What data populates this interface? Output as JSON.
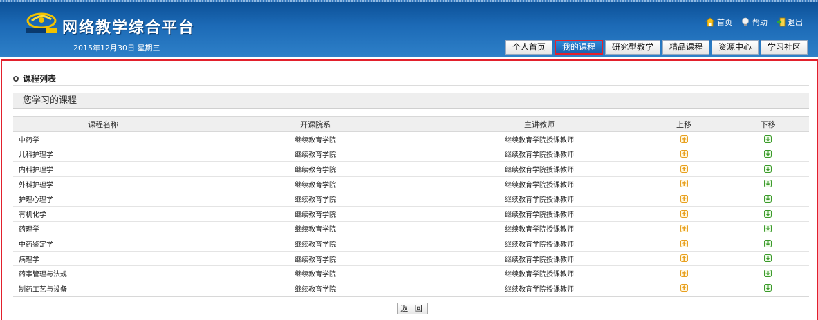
{
  "header": {
    "site_title": "网络教学综合平台",
    "date_text": "2015年12月30日 星期三",
    "logo_icon": "tsinghua-logo-icon",
    "top_links": [
      {
        "label": "首页",
        "icon": "home-icon"
      },
      {
        "label": "帮助",
        "icon": "help-bulb-icon"
      },
      {
        "label": "退出",
        "icon": "exit-icon"
      }
    ],
    "nav_tabs": [
      {
        "label": "个人首页",
        "active": false
      },
      {
        "label": "我的课程",
        "active": true
      },
      {
        "label": "研究型教学",
        "active": false
      },
      {
        "label": "精品课程",
        "active": false
      },
      {
        "label": "资源中心",
        "active": false
      },
      {
        "label": "学习社区",
        "active": false
      }
    ]
  },
  "main": {
    "section_title": "课程列表",
    "subheader": "您学习的课程",
    "table": {
      "columns": [
        "课程名称",
        "开课院系",
        "主讲教师",
        "上移",
        "下移"
      ],
      "rows": [
        {
          "name": "中药学",
          "dept": "继续教育学院",
          "teacher": "继续教育学院授课教师"
        },
        {
          "name": "儿科护理学",
          "dept": "继续教育学院",
          "teacher": "继续教育学院授课教师"
        },
        {
          "name": "内科护理学",
          "dept": "继续教育学院",
          "teacher": "继续教育学院授课教师"
        },
        {
          "name": "外科护理学",
          "dept": "继续教育学院",
          "teacher": "继续教育学院授课教师"
        },
        {
          "name": "护理心理学",
          "dept": "继续教育学院",
          "teacher": "继续教育学院授课教师"
        },
        {
          "name": "有机化学",
          "dept": "继续教育学院",
          "teacher": "继续教育学院授课教师"
        },
        {
          "name": "药理学",
          "dept": "继续教育学院",
          "teacher": "继续教育学院授课教师"
        },
        {
          "name": "中药鉴定学",
          "dept": "继续教育学院",
          "teacher": "继续教育学院授课教师"
        },
        {
          "name": "病理学",
          "dept": "继续教育学院",
          "teacher": "继续教育学院授课教师"
        },
        {
          "name": "药事管理与法规",
          "dept": "继续教育学院",
          "teacher": "继续教育学院授课教师"
        },
        {
          "name": "制药工艺与设备",
          "dept": "继续教育学院",
          "teacher": "继续教育学院授课教师"
        }
      ]
    },
    "back_button": "返 回"
  },
  "colors": {
    "header_blue": "#1c6ab6",
    "highlight_red": "#e2202c",
    "up_arrow": "#e8a020",
    "down_arrow": "#3a9a2a"
  }
}
